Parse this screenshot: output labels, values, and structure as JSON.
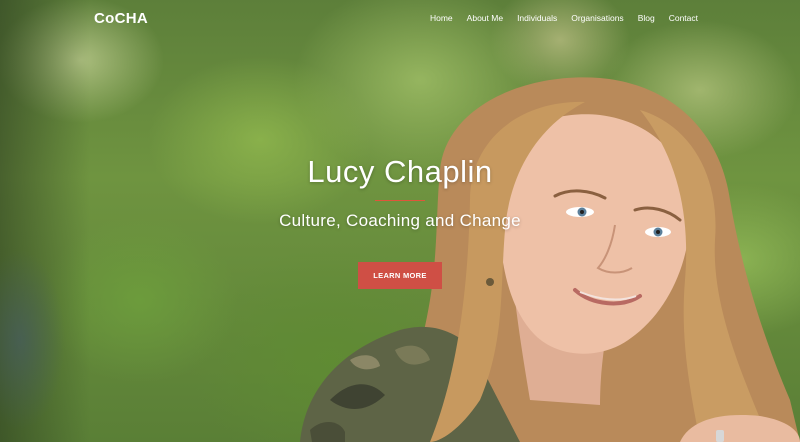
{
  "brand": {
    "logo_text": "CoCHA"
  },
  "nav": {
    "items": [
      {
        "label": "Home"
      },
      {
        "label": "About Me"
      },
      {
        "label": "Individuals"
      },
      {
        "label": "Organisations"
      },
      {
        "label": "Blog"
      },
      {
        "label": "Contact"
      }
    ]
  },
  "hero": {
    "title": "Lucy Chaplin",
    "subtitle": "Culture, Coaching and Change",
    "cta_label": "LEARN MORE",
    "image_subject": "smiling-woman-with-long-blonde-hair-in-camouflage-jacket"
  },
  "colors": {
    "accent": "#cf4f45",
    "divider": "#e0553b",
    "text": "#ffffff",
    "foliage": "#6f9440"
  }
}
